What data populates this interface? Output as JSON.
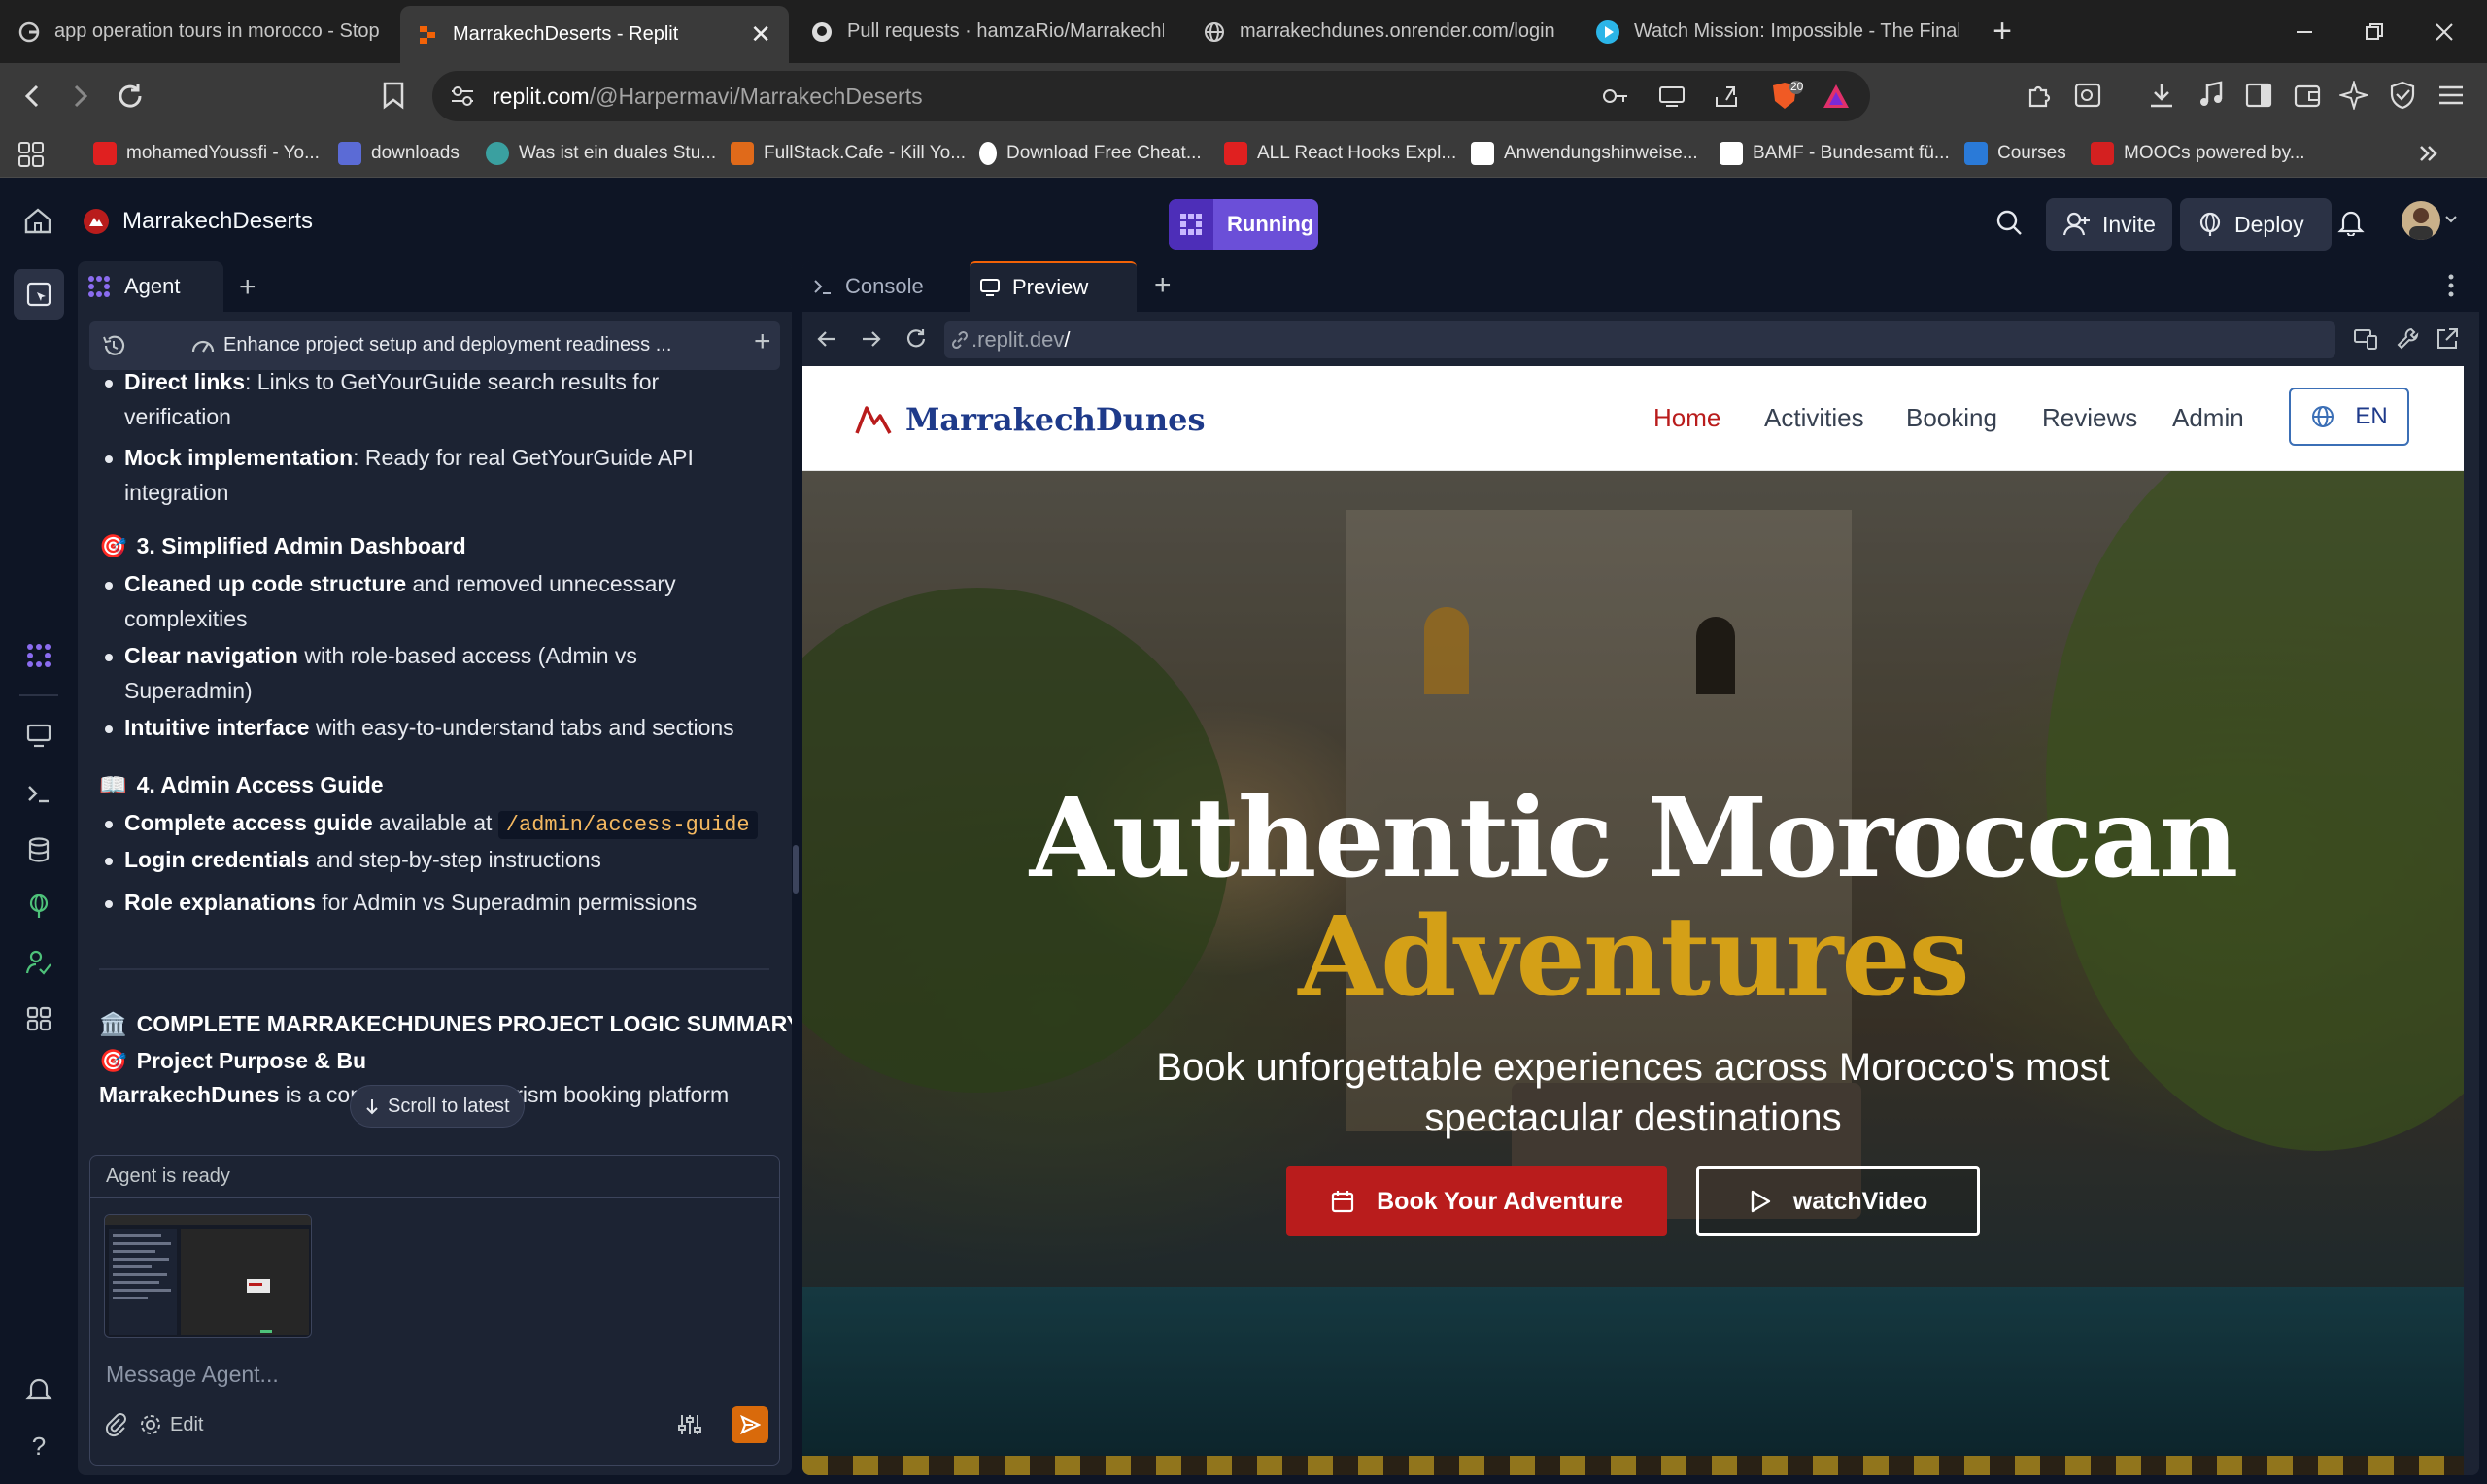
{
  "browser": {
    "tabs": [
      {
        "title": "app operation tours in morocco - Stop p",
        "icon": "google-icon"
      },
      {
        "title": "MarrakechDeserts - Replit",
        "icon": "replit-icon",
        "active": true
      },
      {
        "title": "Pull requests · hamzaRio/MarrakechDun",
        "icon": "github-icon"
      },
      {
        "title": "marrakechdunes.onrender.com/login",
        "icon": "globe-icon"
      },
      {
        "title": "Watch Mission: Impossible - The Final Re",
        "icon": "play-icon"
      }
    ],
    "address": {
      "domain": "replit.com",
      "path": "/@Harpermavi/MarrakechDeserts"
    },
    "brave_badge": "20",
    "bookmarks": [
      {
        "label": "mohamedYoussfi - Yo...",
        "color": "#e02020"
      },
      {
        "label": "downloads",
        "color": "#5b6bd6"
      },
      {
        "label": "Was ist ein duales Stu...",
        "color": "#3aa0a0"
      },
      {
        "label": "FullStack.Cafe - Kill Yo...",
        "color": "#e06a1a"
      },
      {
        "label": "Download Free Cheat...",
        "color": "#ffffff"
      },
      {
        "label": "ALL React Hooks Expl...",
        "color": "#e02020"
      },
      {
        "label": "Anwendungshinweise...",
        "color": "#ffffff"
      },
      {
        "label": "BAMF - Bundesamt fü...",
        "color": "#ffffff"
      },
      {
        "label": "Courses",
        "color": "#2a7ad8"
      },
      {
        "label": "MOOCs powered by...",
        "color": "#d42020"
      }
    ]
  },
  "replit": {
    "project_name": "MarrakechDeserts",
    "status": "Running",
    "invite_label": "Invite",
    "deploy_label": "Deploy"
  },
  "agent": {
    "tab_label": "Agent",
    "chat_title": "Enhance project setup and deployment readiness ...",
    "messages": {
      "line_direct_bold": "Direct links",
      "line_direct_rest": ": Links to GetYourGuide search results for",
      "line_verification": "verification",
      "line_mock_bold": "Mock implementation",
      "line_mock_rest": ": Ready for real GetYourGuide API",
      "line_integration": "integration",
      "sec3_icon": "🎯",
      "sec3_title": "3. Simplified Admin Dashboard",
      "line_clean_bold": "Cleaned up code structure",
      "line_clean_rest": " and removed unnecessary",
      "line_complex": "complexities",
      "line_nav_bold": "Clear navigation",
      "line_nav_rest": " with role-based access (Admin vs",
      "line_super": "Superadmin)",
      "line_intuit_bold": "Intuitive interface",
      "line_intuit_rest": " with easy-to-understand tabs and sections",
      "sec4_icon": "📖",
      "sec4_title": "4. Admin Access Guide",
      "line_guide_bold": "Complete access guide",
      "line_guide_rest": " available at ",
      "line_guide_code": "/admin/access-guide",
      "line_login_bold": "Login credentials",
      "line_login_rest": " and step-by-step instructions",
      "line_role_bold": "Role explanations",
      "line_role_rest": " for Admin vs Superadmin permissions",
      "summary_icon": "🏛️",
      "summary_title": "COMPLETE MARRAKECHDUNES PROJECT LOGIC SUMMARY",
      "purpose_icon": "🎯",
      "purpose_title": "Project Purpose & Bu",
      "last_bold": "MarrakechDunes",
      "last_rest": " is a comprehensive tourism booking platform"
    },
    "scroll_latest": "Scroll to latest",
    "composer_status": "Agent is ready",
    "input_placeholder": "Message Agent...",
    "edit_label": "Edit"
  },
  "workspace": {
    "tabs": [
      {
        "label": "Console",
        "icon": "terminal-icon"
      },
      {
        "label": "Preview",
        "icon": "monitor-icon",
        "active": true
      }
    ],
    "preview_url": {
      "prefix": ".replit.dev",
      "suffix": "/"
    }
  },
  "site": {
    "brand": "MarrakechDunes",
    "nav": [
      "Home",
      "Activities",
      "Booking",
      "Reviews",
      "Admin"
    ],
    "language": "EN",
    "hero_title_line1": "Authentic Moroccan",
    "hero_title_line2": "Adventures",
    "hero_subtitle": "Book unforgettable experiences across Morocco's most spectacular destinations",
    "cta_primary": "Book Your Adventure",
    "cta_secondary": "watchVideo",
    "colors": {
      "accent_red": "#b91c1c",
      "gold": "#d4a017",
      "brand_blue": "#1e3a8a"
    }
  }
}
